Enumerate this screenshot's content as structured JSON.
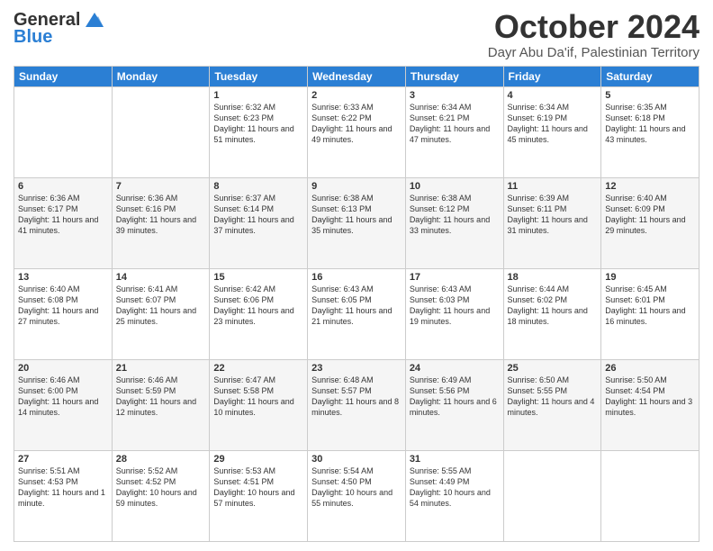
{
  "logo": {
    "line1": "General",
    "line2": "Blue"
  },
  "title": "October 2024",
  "location": "Dayr Abu Da'if, Palestinian Territory",
  "days_of_week": [
    "Sunday",
    "Monday",
    "Tuesday",
    "Wednesday",
    "Thursday",
    "Friday",
    "Saturday"
  ],
  "weeks": [
    [
      {
        "day": "",
        "text": ""
      },
      {
        "day": "",
        "text": ""
      },
      {
        "day": "1",
        "text": "Sunrise: 6:32 AM\nSunset: 6:23 PM\nDaylight: 11 hours and 51 minutes."
      },
      {
        "day": "2",
        "text": "Sunrise: 6:33 AM\nSunset: 6:22 PM\nDaylight: 11 hours and 49 minutes."
      },
      {
        "day": "3",
        "text": "Sunrise: 6:34 AM\nSunset: 6:21 PM\nDaylight: 11 hours and 47 minutes."
      },
      {
        "day": "4",
        "text": "Sunrise: 6:34 AM\nSunset: 6:19 PM\nDaylight: 11 hours and 45 minutes."
      },
      {
        "day": "5",
        "text": "Sunrise: 6:35 AM\nSunset: 6:18 PM\nDaylight: 11 hours and 43 minutes."
      }
    ],
    [
      {
        "day": "6",
        "text": "Sunrise: 6:36 AM\nSunset: 6:17 PM\nDaylight: 11 hours and 41 minutes."
      },
      {
        "day": "7",
        "text": "Sunrise: 6:36 AM\nSunset: 6:16 PM\nDaylight: 11 hours and 39 minutes."
      },
      {
        "day": "8",
        "text": "Sunrise: 6:37 AM\nSunset: 6:14 PM\nDaylight: 11 hours and 37 minutes."
      },
      {
        "day": "9",
        "text": "Sunrise: 6:38 AM\nSunset: 6:13 PM\nDaylight: 11 hours and 35 minutes."
      },
      {
        "day": "10",
        "text": "Sunrise: 6:38 AM\nSunset: 6:12 PM\nDaylight: 11 hours and 33 minutes."
      },
      {
        "day": "11",
        "text": "Sunrise: 6:39 AM\nSunset: 6:11 PM\nDaylight: 11 hours and 31 minutes."
      },
      {
        "day": "12",
        "text": "Sunrise: 6:40 AM\nSunset: 6:09 PM\nDaylight: 11 hours and 29 minutes."
      }
    ],
    [
      {
        "day": "13",
        "text": "Sunrise: 6:40 AM\nSunset: 6:08 PM\nDaylight: 11 hours and 27 minutes."
      },
      {
        "day": "14",
        "text": "Sunrise: 6:41 AM\nSunset: 6:07 PM\nDaylight: 11 hours and 25 minutes."
      },
      {
        "day": "15",
        "text": "Sunrise: 6:42 AM\nSunset: 6:06 PM\nDaylight: 11 hours and 23 minutes."
      },
      {
        "day": "16",
        "text": "Sunrise: 6:43 AM\nSunset: 6:05 PM\nDaylight: 11 hours and 21 minutes."
      },
      {
        "day": "17",
        "text": "Sunrise: 6:43 AM\nSunset: 6:03 PM\nDaylight: 11 hours and 19 minutes."
      },
      {
        "day": "18",
        "text": "Sunrise: 6:44 AM\nSunset: 6:02 PM\nDaylight: 11 hours and 18 minutes."
      },
      {
        "day": "19",
        "text": "Sunrise: 6:45 AM\nSunset: 6:01 PM\nDaylight: 11 hours and 16 minutes."
      }
    ],
    [
      {
        "day": "20",
        "text": "Sunrise: 6:46 AM\nSunset: 6:00 PM\nDaylight: 11 hours and 14 minutes."
      },
      {
        "day": "21",
        "text": "Sunrise: 6:46 AM\nSunset: 5:59 PM\nDaylight: 11 hours and 12 minutes."
      },
      {
        "day": "22",
        "text": "Sunrise: 6:47 AM\nSunset: 5:58 PM\nDaylight: 11 hours and 10 minutes."
      },
      {
        "day": "23",
        "text": "Sunrise: 6:48 AM\nSunset: 5:57 PM\nDaylight: 11 hours and 8 minutes."
      },
      {
        "day": "24",
        "text": "Sunrise: 6:49 AM\nSunset: 5:56 PM\nDaylight: 11 hours and 6 minutes."
      },
      {
        "day": "25",
        "text": "Sunrise: 6:50 AM\nSunset: 5:55 PM\nDaylight: 11 hours and 4 minutes."
      },
      {
        "day": "26",
        "text": "Sunrise: 5:50 AM\nSunset: 4:54 PM\nDaylight: 11 hours and 3 minutes."
      }
    ],
    [
      {
        "day": "27",
        "text": "Sunrise: 5:51 AM\nSunset: 4:53 PM\nDaylight: 11 hours and 1 minute."
      },
      {
        "day": "28",
        "text": "Sunrise: 5:52 AM\nSunset: 4:52 PM\nDaylight: 10 hours and 59 minutes."
      },
      {
        "day": "29",
        "text": "Sunrise: 5:53 AM\nSunset: 4:51 PM\nDaylight: 10 hours and 57 minutes."
      },
      {
        "day": "30",
        "text": "Sunrise: 5:54 AM\nSunset: 4:50 PM\nDaylight: 10 hours and 55 minutes."
      },
      {
        "day": "31",
        "text": "Sunrise: 5:55 AM\nSunset: 4:49 PM\nDaylight: 10 hours and 54 minutes."
      },
      {
        "day": "",
        "text": ""
      },
      {
        "day": "",
        "text": ""
      }
    ]
  ]
}
